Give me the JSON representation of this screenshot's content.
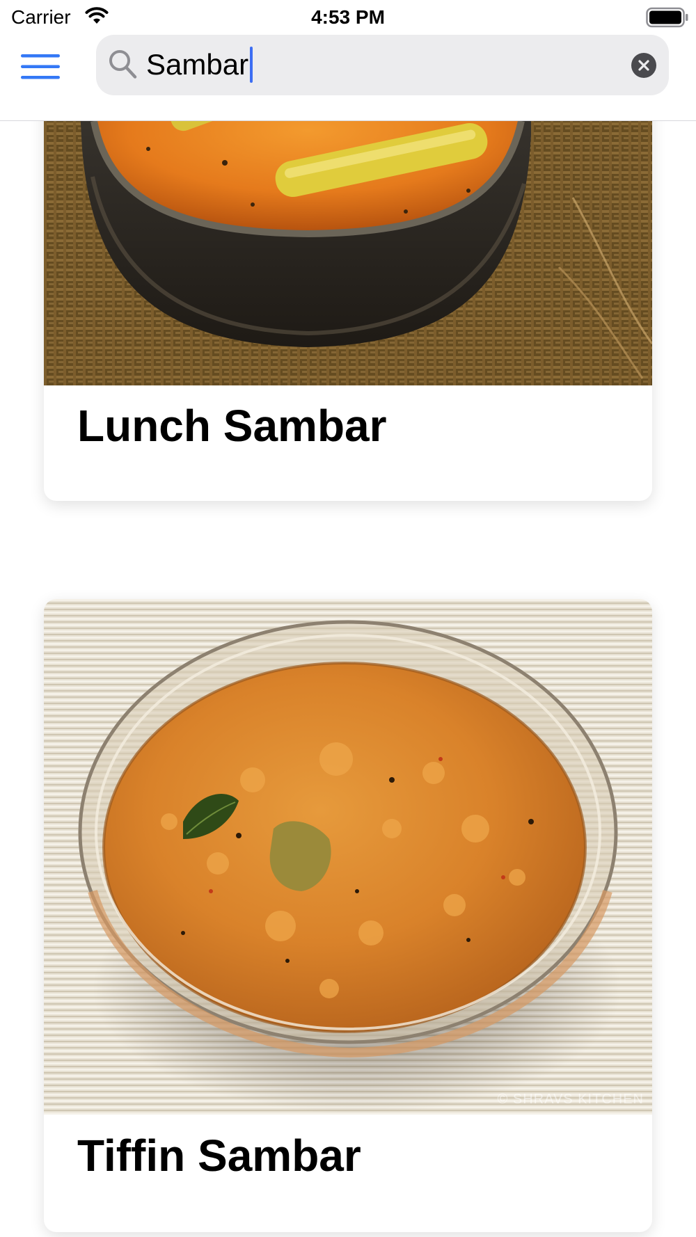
{
  "status_bar": {
    "carrier": "Carrier",
    "time": "4:53 PM"
  },
  "search": {
    "value": "Sambar",
    "accent_color": "#3d6ef3"
  },
  "icons": {
    "menu": "hamburger-menu-icon",
    "search": "magnifier-icon",
    "clear": "clear-x-icon",
    "wifi": "wifi-icon",
    "battery": "battery-icon"
  },
  "results": [
    {
      "title": "Lunch Sambar"
    },
    {
      "title": "Tiffin Sambar",
      "image_watermark": "© SHRAVS KITCHEN"
    }
  ]
}
